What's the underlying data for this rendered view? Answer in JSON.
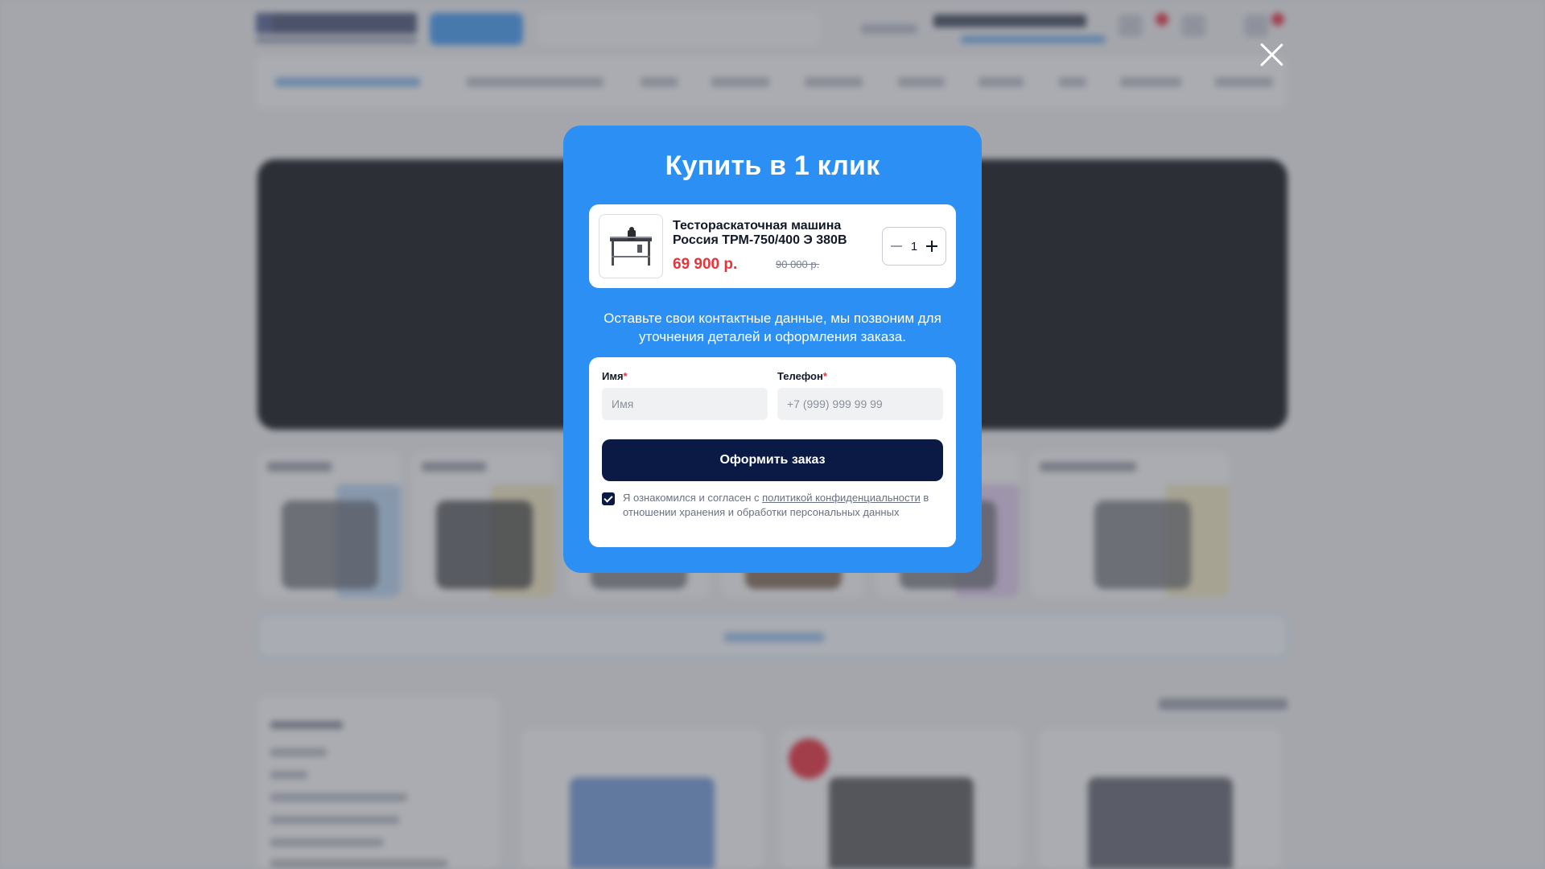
{
  "modal": {
    "title": "Купить в 1 клик",
    "product": {
      "name": "Тестораскаточная машина Россия ТРМ-750/400 Э 380В",
      "price": "69 900 р.",
      "old_price": "90 000 р.",
      "quantity": "1",
      "image_icon": "dough-sheeter-machine-icon"
    },
    "lead_text": "Оставьте свои контактные данные, мы позвоним для уточнения деталей и оформления заказа.",
    "form": {
      "name_label": "Имя",
      "name_placeholder": "Имя",
      "phone_label": "Телефон",
      "phone_placeholder": "+7 (999) 999 99 99",
      "required_mark": "*",
      "submit_label": "Оформить заказ"
    },
    "consent": {
      "checked": true,
      "text_before": "Я ознакомился и согласен с ",
      "link_text": "политикой конфиденциальности",
      "text_after": " в отношении хранения и обработки персональных данных"
    }
  },
  "colors": {
    "modal_bg": "#2b8ff3",
    "submit_bg": "#0a1a45",
    "price": "#e8333a"
  }
}
